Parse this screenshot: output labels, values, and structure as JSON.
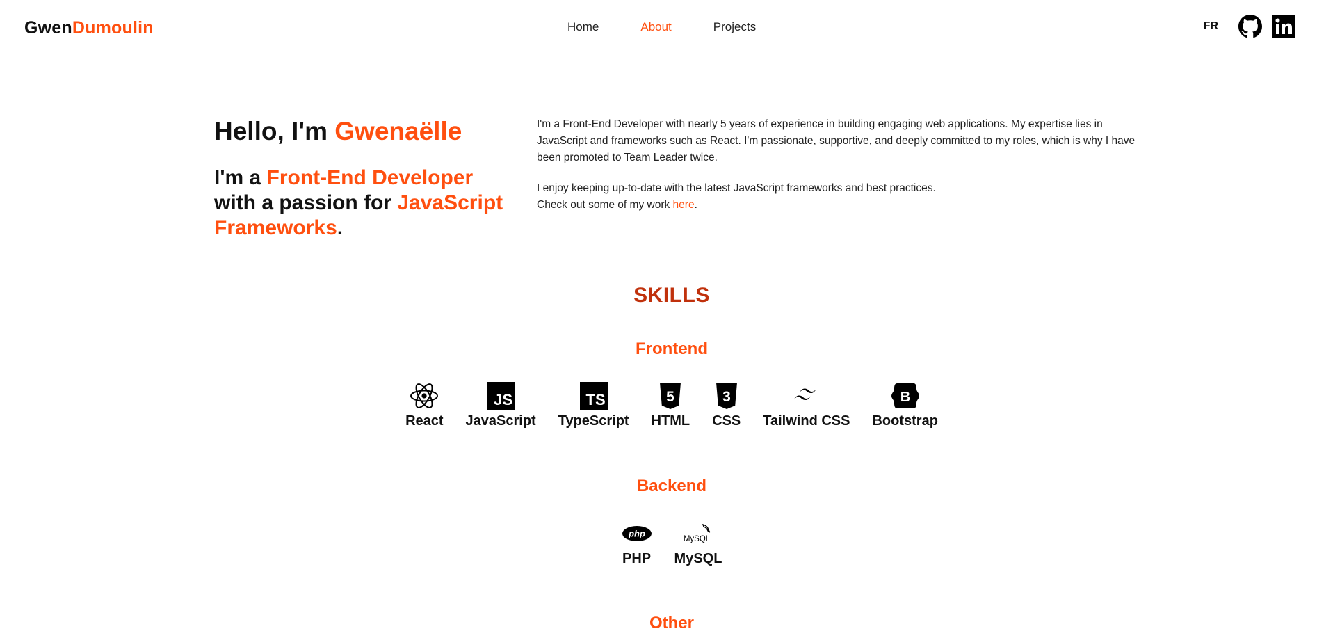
{
  "header": {
    "logo_first": "Gwen",
    "logo_second": "Dumoulin",
    "nav": [
      {
        "label": "Home"
      },
      {
        "label": "About"
      },
      {
        "label": "Projects"
      }
    ],
    "lang": "FR",
    "icons": [
      "github-icon",
      "linkedin-icon"
    ]
  },
  "intro": {
    "hello_prefix": "Hello, I'm ",
    "hello_name": "Gwenaëlle",
    "tag_1": "I'm a ",
    "tag_2": "Front-End Developer",
    "tag_3": " with a passion for ",
    "tag_4": "JavaScript Frameworks",
    "tag_5": ".",
    "para1": "I'm a Front-End Developer with nearly 5 years of experience in building engaging web applications. My expertise lies in JavaScript and frameworks such as React. I'm passionate, supportive, and deeply committed to my roles, which is why I have been promoted to Team Leader twice.",
    "para2_line1": "I enjoy keeping up-to-date with the latest JavaScript frameworks and best practices.",
    "para2_line2": "Check out some of my work ",
    "link": "here",
    "period": "."
  },
  "skills": {
    "title": "SKILLS",
    "frontend_title": "Frontend",
    "frontend": [
      {
        "label": "React",
        "icon": "react-icon"
      },
      {
        "label": "JavaScript",
        "icon": "javascript-icon",
        "glyph": "JS"
      },
      {
        "label": "TypeScript",
        "icon": "typescript-icon",
        "glyph": "TS"
      },
      {
        "label": "HTML",
        "icon": "html5-icon",
        "glyph": "5"
      },
      {
        "label": "CSS",
        "icon": "css3-icon",
        "glyph": "3"
      },
      {
        "label": "Tailwind CSS",
        "icon": "tailwind-icon"
      },
      {
        "label": "Bootstrap",
        "icon": "bootstrap-icon",
        "glyph": "B"
      }
    ],
    "backend_title": "Backend",
    "backend": [
      {
        "label": "PHP",
        "icon": "php-icon",
        "glyph": "php"
      },
      {
        "label": "MySQL",
        "icon": "mysql-icon",
        "glyph": "MySQL"
      }
    ],
    "other_title": "Other"
  },
  "colors": {
    "accent": "#ff4f0f",
    "skills_title": "#c0310c",
    "text": "#111111"
  }
}
